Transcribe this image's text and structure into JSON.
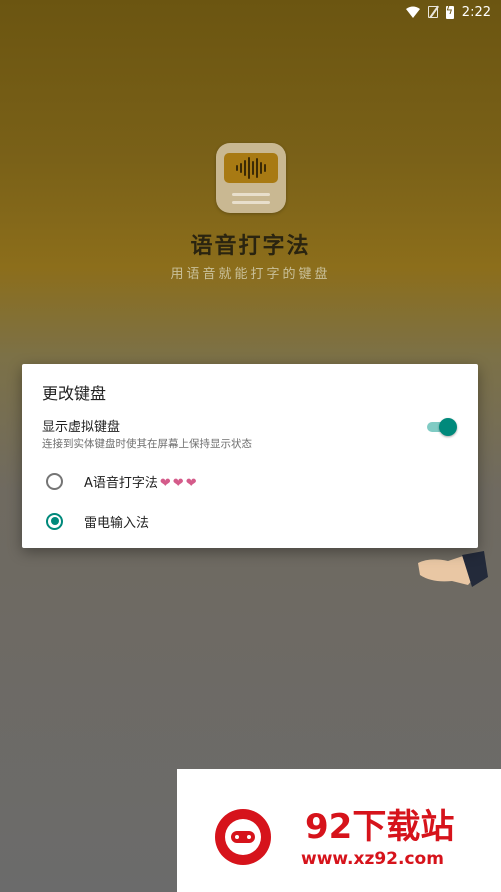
{
  "status_bar": {
    "time": "2:22",
    "icons": [
      "wifi-icon",
      "no-sim-icon",
      "battery-charging-icon"
    ]
  },
  "app": {
    "title": "语音打字法",
    "subtitle": "用语音就能打字的键盘",
    "icon": "voice-keyboard-logo-icon"
  },
  "dialog": {
    "title": "更改键盘",
    "toggle": {
      "label": "显示虚拟键盘",
      "description": "连接到实体键盘时使其在屏幕上保持显示状态",
      "on": true
    },
    "options": [
      {
        "label": "A语音打字法",
        "suffix": "❤❤❤",
        "selected": false
      },
      {
        "label": "雷电输入法",
        "suffix": "",
        "selected": true
      }
    ]
  },
  "watermark": {
    "title": "92下载站",
    "url": "www.xz92.com"
  },
  "colors": {
    "accent": "#00897b",
    "accent_light": "#80cbc4",
    "watermark_red": "#d6131b",
    "background_top": "#6b5511"
  }
}
